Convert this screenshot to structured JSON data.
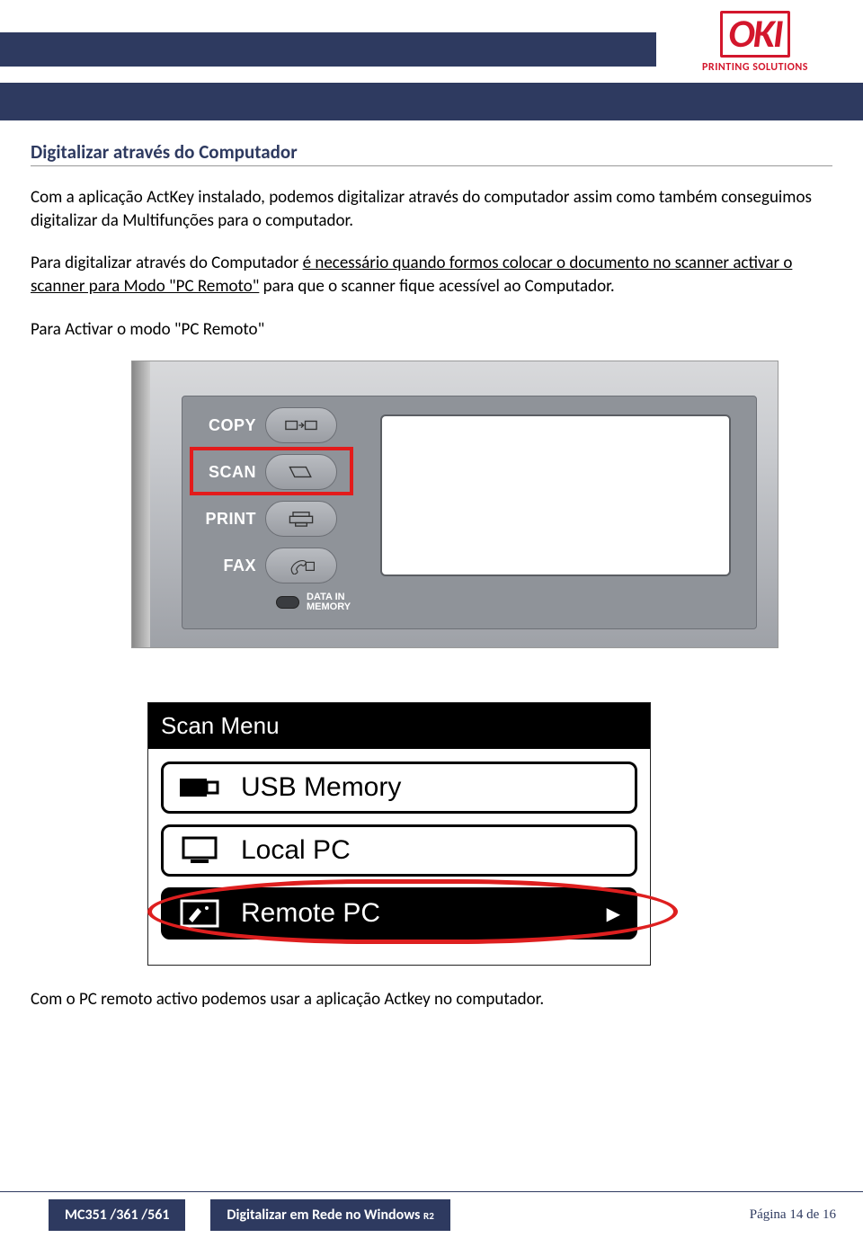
{
  "logo": {
    "text": "OKI",
    "tag": "PRINTING SOLUTIONS"
  },
  "section_title": "Digitalizar através do Computador",
  "para1": "Com a aplicação ActKey instalado, podemos digitalizar através do computador assim como também conseguimos digitalizar da Multifunções para o computador.",
  "para2_pre": "Para digitalizar através do Computador ",
  "para2_u": "é necessário quando formos colocar o documento no scanner activar o scanner para Modo \"PC Remoto\"",
  "para2_post": " para que o scanner fique acessível ao Computador.",
  "para3": "Para Activar o modo \"PC Remoto\"",
  "panel": {
    "copy": "COPY",
    "scan": "SCAN",
    "print": "PRINT",
    "fax": "FAX",
    "data_line1": "DATA IN",
    "data_line2": "MEMORY"
  },
  "menu": {
    "header": "Scan Menu",
    "item1": "USB Memory",
    "item2": "Local PC",
    "item3": "Remote PC"
  },
  "para4": "Com o PC remoto activo podemos usar a aplicação Actkey no computador.",
  "footer": {
    "box1": "MC351 /361 /561",
    "box2_main": "Digitalizar em Rede no Windows ",
    "box2_sub": "R2",
    "page": "Página 14 de 16"
  }
}
